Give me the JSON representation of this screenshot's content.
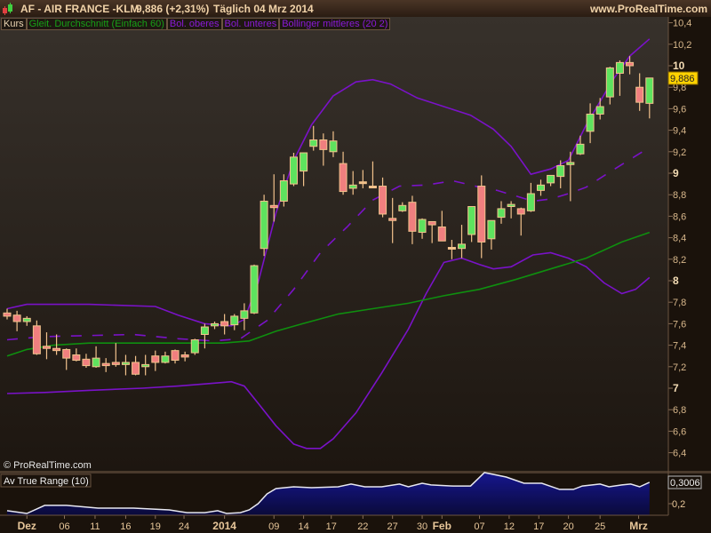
{
  "header": {
    "symbol": "AF - AIR FRANCE -KLM",
    "last": "9,886 (+2,31%)",
    "period": "Täglich  04 Mrz 2014",
    "site": "www.ProRealTime.com"
  },
  "legend": {
    "kurs": "Kurs",
    "sma": "Gleit. Durchschnitt (Einfach 60)",
    "bol_upper": "Bol. oberes",
    "bol_lower": "Bol. unteres",
    "bol_mid": "Bollinger mittleres (20 2)"
  },
  "colors": {
    "up": "#5ee35e",
    "down": "#f07f7f",
    "border": "#f2c28c",
    "bollinger": "#7a12c8",
    "sma": "#0f8f0f",
    "atr_fill": "#14148a",
    "price_tag": "#ffd200"
  },
  "copyright": "© ProRealTime.com",
  "price_tag": "9,886",
  "atr": {
    "title": "Av True Range (10)",
    "value_tag": "0,3006",
    "tick_label": "0,2"
  },
  "chart_data": {
    "type": "candlestick",
    "title": "AF - AIR FRANCE -KLM",
    "ylim": [
      6.2,
      10.45
    ],
    "yticks": [
      "6,4",
      "6,6",
      "6,8",
      "7",
      "7,2",
      "7,4",
      "7,6",
      "7,8",
      "8",
      "8,2",
      "8,4",
      "8,6",
      "8,8",
      "9",
      "9,2",
      "9,4",
      "9,6",
      "9,8",
      "10",
      "10,2",
      "10,4"
    ],
    "xticks": [
      [
        2,
        "Dez"
      ],
      [
        5.8,
        "06"
      ],
      [
        8.9,
        "11"
      ],
      [
        12,
        "16"
      ],
      [
        15,
        "19"
      ],
      [
        17.9,
        "24"
      ],
      [
        22,
        "2014"
      ],
      [
        27,
        "09"
      ],
      [
        30,
        "14"
      ],
      [
        32.8,
        "17"
      ],
      [
        36,
        "22"
      ],
      [
        39,
        "27"
      ],
      [
        42,
        "30"
      ],
      [
        44,
        "Feb"
      ],
      [
        47.8,
        "07"
      ],
      [
        50.8,
        "12"
      ],
      [
        53.8,
        "17"
      ],
      [
        56.8,
        "20"
      ],
      [
        60,
        "25"
      ],
      [
        63.9,
        "Mrz"
      ]
    ],
    "ohlc": [
      [
        7.7,
        7.74,
        7.64,
        7.67
      ],
      [
        7.68,
        7.72,
        7.53,
        7.62
      ],
      [
        7.62,
        7.67,
        7.58,
        7.65
      ],
      [
        7.58,
        7.63,
        7.31,
        7.32
      ],
      [
        7.39,
        7.52,
        7.27,
        7.37
      ],
      [
        7.37,
        7.5,
        7.31,
        7.35
      ],
      [
        7.36,
        7.37,
        7.17,
        7.28
      ],
      [
        7.31,
        7.37,
        7.25,
        7.26
      ],
      [
        7.27,
        7.32,
        7.19,
        7.21
      ],
      [
        7.2,
        7.39,
        7.19,
        7.28
      ],
      [
        7.23,
        7.28,
        7.15,
        7.21
      ],
      [
        7.24,
        7.42,
        7.2,
        7.22
      ],
      [
        7.22,
        7.31,
        7.12,
        7.24
      ],
      [
        7.24,
        7.3,
        7.12,
        7.13
      ],
      [
        7.2,
        7.31,
        7.12,
        7.22
      ],
      [
        7.3,
        7.35,
        7.16,
        7.24
      ],
      [
        7.24,
        7.34,
        7.23,
        7.3
      ],
      [
        7.35,
        7.36,
        7.23,
        7.26
      ],
      [
        7.31,
        7.34,
        7.25,
        7.29
      ],
      [
        7.33,
        7.46,
        7.31,
        7.45
      ],
      [
        7.5,
        7.6,
        7.37,
        7.57
      ],
      [
        7.58,
        7.62,
        7.55,
        7.6
      ],
      [
        7.62,
        7.69,
        7.5,
        7.58
      ],
      [
        7.59,
        7.69,
        7.54,
        7.67
      ],
      [
        7.65,
        7.79,
        7.54,
        7.72
      ],
      [
        7.7,
        8.15,
        7.69,
        8.14
      ],
      [
        8.3,
        8.8,
        8.23,
        8.74
      ],
      [
        8.7,
        8.99,
        8.55,
        8.68
      ],
      [
        8.74,
        8.99,
        8.69,
        8.93
      ],
      [
        8.9,
        9.19,
        8.88,
        9.15
      ],
      [
        9.02,
        9.19,
        8.88,
        9.19
      ],
      [
        9.25,
        9.44,
        9.21,
        9.31
      ],
      [
        9.31,
        9.37,
        9.07,
        9.22
      ],
      [
        9.2,
        9.39,
        9.15,
        9.3
      ],
      [
        9.09,
        9.2,
        8.8,
        8.83
      ],
      [
        8.86,
        9.02,
        8.8,
        8.89
      ],
      [
        8.92,
        9.03,
        8.86,
        8.92
      ],
      [
        8.88,
        9.11,
        8.86,
        8.88
      ],
      [
        8.88,
        8.96,
        8.59,
        8.62
      ],
      [
        8.58,
        8.77,
        8.35,
        8.56
      ],
      [
        8.65,
        8.73,
        8.64,
        8.7
      ],
      [
        8.73,
        8.79,
        8.34,
        8.46
      ],
      [
        8.45,
        8.58,
        8.39,
        8.57
      ],
      [
        8.55,
        8.55,
        8.35,
        8.52
      ],
      [
        8.5,
        8.65,
        8.37,
        8.37
      ],
      [
        8.31,
        8.38,
        8.2,
        8.31
      ],
      [
        8.3,
        8.52,
        8.21,
        8.34
      ],
      [
        8.43,
        8.69,
        8.36,
        8.69
      ],
      [
        8.88,
        8.98,
        8.21,
        8.36
      ],
      [
        8.39,
        8.56,
        8.29,
        8.56
      ],
      [
        8.59,
        8.74,
        8.53,
        8.67
      ],
      [
        8.69,
        8.74,
        8.58,
        8.71
      ],
      [
        8.67,
        8.68,
        8.42,
        8.62
      ],
      [
        8.65,
        8.91,
        8.64,
        8.81
      ],
      [
        8.84,
        8.94,
        8.79,
        8.89
      ],
      [
        8.91,
        8.98,
        8.88,
        8.98
      ],
      [
        8.97,
        9.12,
        8.86,
        9.07
      ],
      [
        9.08,
        9.2,
        8.74,
        9.1
      ],
      [
        9.18,
        9.35,
        9.17,
        9.27
      ],
      [
        9.39,
        9.65,
        9.28,
        9.55
      ],
      [
        9.55,
        9.7,
        9.5,
        9.62
      ],
      [
        9.71,
        9.99,
        9.64,
        9.98
      ],
      [
        9.93,
        10.05,
        9.72,
        10.03
      ],
      [
        10.03,
        10.09,
        9.92,
        10.0
      ],
      [
        9.8,
        9.93,
        9.58,
        9.66
      ],
      [
        9.65,
        9.886,
        9.51,
        9.886
      ]
    ],
    "series": [
      {
        "name": "Bol. oberes",
        "style": "solid",
        "points": [
          [
            0,
            7.74
          ],
          [
            2,
            7.78
          ],
          [
            8.3,
            7.78
          ],
          [
            15,
            7.76
          ],
          [
            17.3,
            7.68
          ],
          [
            20,
            7.6
          ],
          [
            22.7,
            7.58
          ],
          [
            24,
            7.64
          ],
          [
            25.4,
            7.98
          ],
          [
            27.2,
            8.63
          ],
          [
            29,
            9.12
          ],
          [
            30.8,
            9.45
          ],
          [
            33,
            9.72
          ],
          [
            35.3,
            9.85
          ],
          [
            37,
            9.87
          ],
          [
            38.8,
            9.83
          ],
          [
            41.5,
            9.7
          ],
          [
            44.2,
            9.62
          ],
          [
            46.9,
            9.54
          ],
          [
            49.2,
            9.41
          ],
          [
            51,
            9.25
          ],
          [
            53,
            8.99
          ],
          [
            55,
            9.04
          ],
          [
            56.8,
            9.12
          ],
          [
            58.6,
            9.45
          ],
          [
            61.3,
            9.87
          ],
          [
            63,
            10.09
          ],
          [
            65,
            10.25
          ]
        ]
      },
      {
        "name": "Bol. unteres",
        "style": "solid",
        "points": [
          [
            0,
            6.95
          ],
          [
            3.8,
            6.96
          ],
          [
            8.3,
            6.98
          ],
          [
            13.7,
            7.0
          ],
          [
            17.3,
            7.02
          ],
          [
            20,
            7.04
          ],
          [
            22.7,
            7.06
          ],
          [
            24,
            7.02
          ],
          [
            25.4,
            6.86
          ],
          [
            27.2,
            6.65
          ],
          [
            29,
            6.48
          ],
          [
            30.3,
            6.44
          ],
          [
            31.7,
            6.44
          ],
          [
            33,
            6.53
          ],
          [
            35.3,
            6.77
          ],
          [
            37.9,
            7.14
          ],
          [
            40.6,
            7.55
          ],
          [
            42.4,
            7.88
          ],
          [
            44.2,
            8.17
          ],
          [
            46,
            8.21
          ],
          [
            47.8,
            8.15
          ],
          [
            49.2,
            8.11
          ],
          [
            51,
            8.13
          ],
          [
            53.2,
            8.24
          ],
          [
            55,
            8.26
          ],
          [
            56.8,
            8.21
          ],
          [
            58.6,
            8.13
          ],
          [
            60.4,
            7.98
          ],
          [
            62.2,
            7.88
          ],
          [
            63.6,
            7.92
          ],
          [
            65,
            8.03
          ]
        ]
      },
      {
        "name": "Bollinger mittleres (20 2)",
        "style": "dashed",
        "points": [
          [
            0,
            7.45
          ],
          [
            3.8,
            7.48
          ],
          [
            8.3,
            7.49
          ],
          [
            12.8,
            7.5
          ],
          [
            17.3,
            7.46
          ],
          [
            20.9,
            7.44
          ],
          [
            23.6,
            7.46
          ],
          [
            26.3,
            7.63
          ],
          [
            29,
            7.92
          ],
          [
            31.7,
            8.26
          ],
          [
            34.4,
            8.5
          ],
          [
            37,
            8.75
          ],
          [
            39.7,
            8.88
          ],
          [
            42.4,
            8.89
          ],
          [
            45.1,
            8.93
          ],
          [
            47.8,
            8.87
          ],
          [
            49.6,
            8.84
          ],
          [
            51.4,
            8.79
          ],
          [
            53.2,
            8.74
          ],
          [
            55,
            8.76
          ],
          [
            56.8,
            8.81
          ],
          [
            58.6,
            8.87
          ],
          [
            61.3,
            9.03
          ],
          [
            63.6,
            9.16
          ],
          [
            65,
            9.24
          ]
        ]
      },
      {
        "name": "Gleit. Durchschnitt (Einfach 60)",
        "style": "solid",
        "points": [
          [
            0,
            7.3
          ],
          [
            2,
            7.36
          ],
          [
            4.7,
            7.4
          ],
          [
            8.3,
            7.42
          ],
          [
            21.8,
            7.42
          ],
          [
            24.5,
            7.44
          ],
          [
            27.2,
            7.53
          ],
          [
            29.9,
            7.6
          ],
          [
            33.5,
            7.69
          ],
          [
            37,
            7.74
          ],
          [
            40.6,
            7.79
          ],
          [
            44.2,
            7.86
          ],
          [
            47.8,
            7.92
          ],
          [
            51.4,
            8.01
          ],
          [
            55,
            8.11
          ],
          [
            58.6,
            8.21
          ],
          [
            62.2,
            8.36
          ],
          [
            65,
            8.45
          ]
        ]
      }
    ],
    "atr": {
      "ylim": [
        0.14,
        0.36
      ],
      "points": [
        [
          0,
          0.167
        ],
        [
          2,
          0.154
        ],
        [
          3.8,
          0.192
        ],
        [
          6,
          0.192
        ],
        [
          9.2,
          0.179
        ],
        [
          12.8,
          0.179
        ],
        [
          16.4,
          0.171
        ],
        [
          18.2,
          0.158
        ],
        [
          20,
          0.158
        ],
        [
          21.3,
          0.167
        ],
        [
          22.2,
          0.154
        ],
        [
          23.6,
          0.158
        ],
        [
          24.5,
          0.171
        ],
        [
          25.4,
          0.2
        ],
        [
          26.3,
          0.246
        ],
        [
          27.2,
          0.271
        ],
        [
          29,
          0.279
        ],
        [
          30.8,
          0.275
        ],
        [
          33.5,
          0.279
        ],
        [
          34.8,
          0.292
        ],
        [
          36.2,
          0.279
        ],
        [
          37.9,
          0.279
        ],
        [
          39.7,
          0.292
        ],
        [
          40.6,
          0.279
        ],
        [
          42,
          0.296
        ],
        [
          42.9,
          0.288
        ],
        [
          45.1,
          0.283
        ],
        [
          46.9,
          0.283
        ],
        [
          48.3,
          0.346
        ],
        [
          50.5,
          0.325
        ],
        [
          52.3,
          0.296
        ],
        [
          54.1,
          0.296
        ],
        [
          55.9,
          0.267
        ],
        [
          57.3,
          0.267
        ],
        [
          58.2,
          0.283
        ],
        [
          60,
          0.292
        ],
        [
          60.9,
          0.279
        ],
        [
          62.2,
          0.288
        ],
        [
          63.1,
          0.292
        ],
        [
          64,
          0.279
        ],
        [
          65,
          0.3006
        ]
      ]
    }
  }
}
